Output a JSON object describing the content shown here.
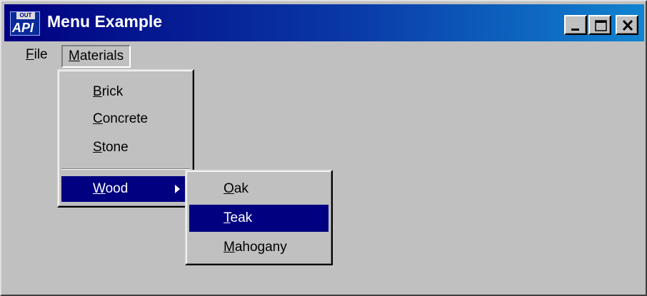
{
  "window": {
    "title": "Menu Example",
    "icon": "api-spy-app-icon",
    "icon_text_top": "OUT",
    "icon_text_bottom": "API",
    "caption_buttons": [
      "minimize",
      "maximize",
      "close"
    ]
  },
  "menubar": {
    "items": [
      {
        "label": "File",
        "mnemonic": "F",
        "rest": "ile"
      },
      {
        "label": "Materials",
        "mnemonic": "M",
        "rest": "aterials",
        "state": "open"
      }
    ]
  },
  "materials_menu": {
    "items": [
      {
        "label": "Brick",
        "mnemonic": "B",
        "rest": "rick"
      },
      {
        "label": "Concrete",
        "mnemonic": "C",
        "rest": "oncrete"
      },
      {
        "label": "Stone",
        "mnemonic": "S",
        "rest": "tone"
      },
      {
        "label": "Wood",
        "mnemonic": "W",
        "rest": "ood",
        "submenu": true,
        "highlighted": true
      }
    ]
  },
  "wood_submenu": {
    "items": [
      {
        "label": "Oak",
        "mnemonic": "O",
        "rest": "ak"
      },
      {
        "label": "Teak",
        "mnemonic": "T",
        "rest": "eak",
        "highlighted": true
      },
      {
        "label": "Mahogany",
        "mnemonic": "M",
        "rest": "ahogany"
      }
    ]
  },
  "colors": {
    "title_gradient_start": "#000080",
    "title_gradient_end": "#1084d0",
    "face": "#c0c0c0",
    "highlight": "#000080"
  }
}
